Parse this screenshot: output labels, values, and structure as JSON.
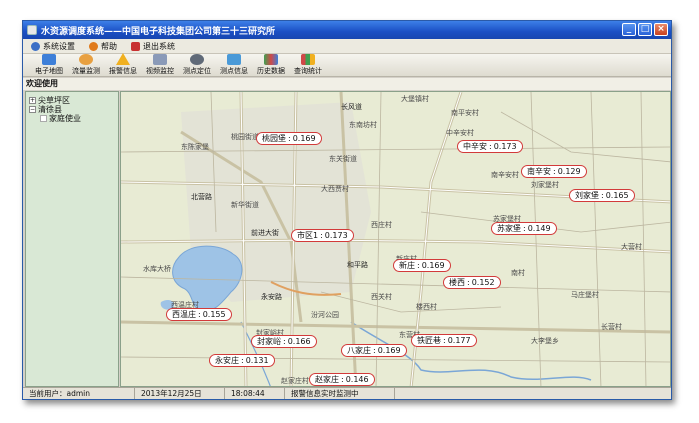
{
  "window": {
    "title": "水资源调度系统——中国电子科技集团公司第三十三研究所"
  },
  "menu": [
    {
      "label": "系统设置",
      "icon": "gear-icon",
      "color": "#3b6fc6"
    },
    {
      "label": "帮助",
      "icon": "help-icon",
      "color": "#e07a1a"
    },
    {
      "label": "退出系统",
      "icon": "exit-icon",
      "color": "#c83030"
    }
  ],
  "toolbar": [
    {
      "label": "电子地图",
      "icon": "map-icon",
      "color": "#3d7fd8"
    },
    {
      "label": "流量监测",
      "icon": "flow-icon",
      "color": "#e8a040"
    },
    {
      "label": "报警信息",
      "icon": "warning-icon",
      "color": "#f0b020"
    },
    {
      "label": "视频监控",
      "icon": "camera-icon",
      "color": "#8a9ab8"
    },
    {
      "label": "测点定位",
      "icon": "locate-icon",
      "color": "#606a78"
    },
    {
      "label": "测点信息",
      "icon": "info-icon",
      "color": "#4a9ad8"
    },
    {
      "label": "历史数据",
      "icon": "history-icon",
      "color": "#40a050"
    },
    {
      "label": "查询统计",
      "icon": "stats-icon",
      "color": "#d04848"
    }
  ],
  "welcome": "欢迎使用",
  "tree": [
    {
      "label": "尖草坪区",
      "toggle": "+"
    },
    {
      "label": "清徐县",
      "toggle": "−"
    },
    {
      "label": "家庭使业",
      "toggle": ""
    }
  ],
  "pins": [
    {
      "name": "桃园堡",
      "value": "0.169"
    },
    {
      "name": "中辛安",
      "value": "0.173"
    },
    {
      "name": "南辛安",
      "value": "0.129"
    },
    {
      "name": "刘家堡",
      "value": "0.165"
    },
    {
      "name": "苏家堡",
      "value": "0.149"
    },
    {
      "name": "市区1",
      "value": "0.173"
    },
    {
      "name": "新庄",
      "value": "0.169"
    },
    {
      "name": "楼西",
      "value": "0.152"
    },
    {
      "name": "西温庄",
      "value": "0.155"
    },
    {
      "name": "封家峪",
      "value": "0.166"
    },
    {
      "name": "八家庄",
      "value": "0.169"
    },
    {
      "name": "铁匠巷",
      "value": "0.177"
    },
    {
      "name": "永安庄",
      "value": "0.131"
    },
    {
      "name": "赵家庄",
      "value": "0.146"
    }
  ],
  "map_labels": [
    "大堡镇村",
    "东南坊村",
    "南平安村",
    "中辛安村",
    "东关街道",
    "大西贾村",
    "南辛安村",
    "刘家堡村",
    "苏家堡村",
    "桃园街道",
    "东陈家堡",
    "新华街道",
    "长风道",
    "新庄村",
    "楼西村",
    "西关村",
    "马庄堡村",
    "大李堡乡",
    "北营路",
    "前进大街",
    "和平路",
    "西温庄村",
    "汾河公园",
    "永安路",
    "水库大桥",
    "封家峪村",
    "东营村",
    "赵家庄村",
    "长营村",
    "南村",
    "西庄村",
    "大营村"
  ],
  "status": {
    "user": "当前用户：admin",
    "date": "2013年12月25日",
    "time": "18:08:44",
    "message": "报警信息实时监测中"
  }
}
